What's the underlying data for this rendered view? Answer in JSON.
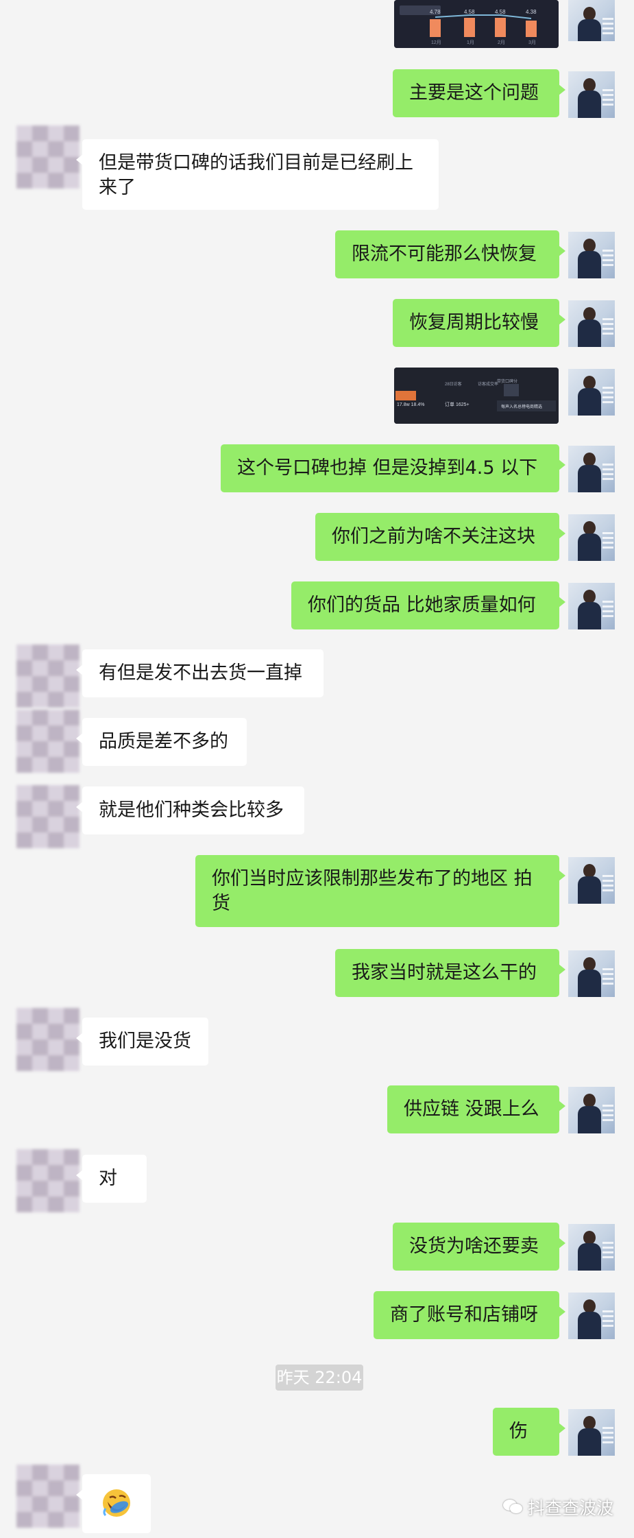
{
  "chat": {
    "messages": [
      {
        "from": "me",
        "text": "主要是这个问题"
      },
      {
        "from": "other",
        "text": "但是带货口碑的话我们目前是已经刷上\n来了"
      },
      {
        "from": "me",
        "text": "限流不可能那么快恢复"
      },
      {
        "from": "me",
        "text": "恢复周期比较慢"
      },
      {
        "from": "me",
        "text": "这个号口碑也掉 但是没掉到4.5 以下"
      },
      {
        "from": "me",
        "text": "你们之前为啥不关注这块"
      },
      {
        "from": "me",
        "text": "你们的货品 比她家质量如何"
      },
      {
        "from": "other",
        "text": "有但是发不出去货一直掉"
      },
      {
        "from": "other",
        "text": "品质是差不多的"
      },
      {
        "from": "other",
        "text": "就是他们种类会比较多"
      },
      {
        "from": "me",
        "text": "你们当时应该限制那些发布了的地区 拍\n货"
      },
      {
        "from": "me",
        "text": "我家当时就是这么干的"
      },
      {
        "from": "other",
        "text": "我们是没货"
      },
      {
        "from": "me",
        "text": "供应链 没跟上么"
      },
      {
        "from": "other",
        "text": "对"
      },
      {
        "from": "me",
        "text": "没货为啥还要卖"
      },
      {
        "from": "me",
        "text": "商了账号和店铺呀"
      },
      {
        "from": "me",
        "text": "伤"
      }
    ],
    "timestamp": "昨天 22:04",
    "reaction_emoji": "facepalm-laugh-emoji",
    "chart_screenshot": {
      "bar_labels": [
        "4.78",
        "4.58",
        "4.58",
        "4.38"
      ],
      "x_labels": [
        "12月",
        "1月",
        "2月",
        "3月"
      ]
    },
    "stats_screenshot": {
      "items": [
        "28日访客",
        "访客成交率",
        "带货口碑分"
      ],
      "values": [
        "17.8w 18.4%",
        "订单 1625+",
        "每声入名总榜电商精选"
      ]
    }
  },
  "watermark": {
    "text": "抖查查波波"
  },
  "colors": {
    "me_bubble": "#95ec69",
    "other_bubble": "#ffffff",
    "background": "#f4f4f4"
  }
}
